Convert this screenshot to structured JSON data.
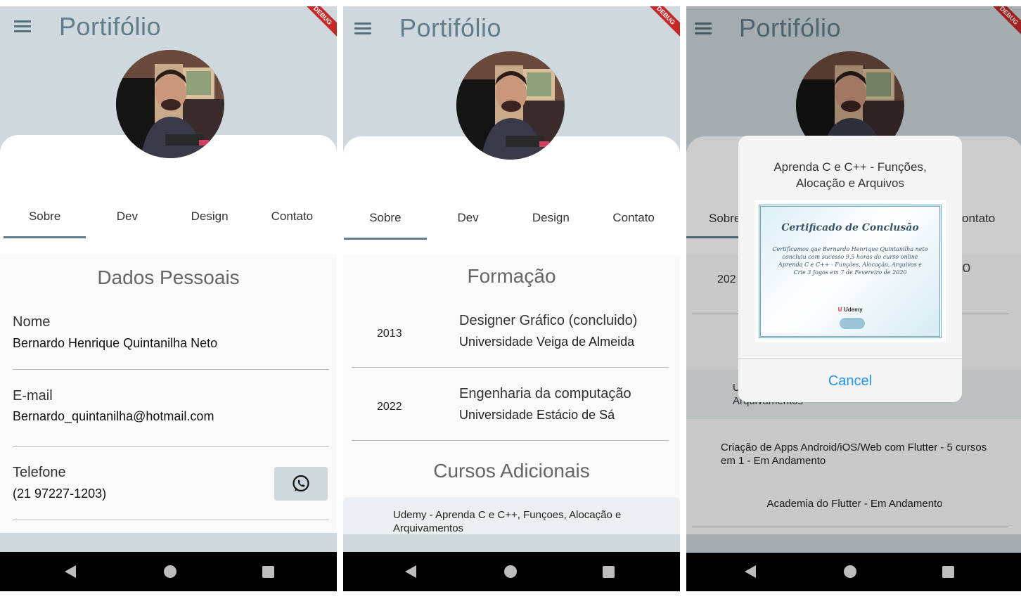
{
  "app": {
    "title": "Portifólio",
    "debug_banner": "DEBUG"
  },
  "tabs": [
    "Sobre",
    "Dev",
    "Design",
    "Contato"
  ],
  "screen1": {
    "section_title": "Dados Pessoais",
    "fields": [
      {
        "label": "Nome",
        "value": "Bernardo Henrique Quintanilha Neto"
      },
      {
        "label": "E-mail",
        "value": "Bernardo_quintanilha@hotmail.com"
      },
      {
        "label": "Telefone",
        "value": "(21 97227-1203)"
      }
    ]
  },
  "screen2": {
    "formacao_title": "Formação",
    "education": [
      {
        "year": "2013",
        "course": "Designer Gráfico (concluido)",
        "school": "Universidade Veiga de Almeida"
      },
      {
        "year": "2022",
        "course": "Engenharia da computação",
        "school": "Universidade Estácio de Sá"
      }
    ],
    "cursos_title": "Cursos Adicionais",
    "extra_courses": [
      "Udemy - Aprenda C e C++, Funçoes, Alocação e Arquivamentos"
    ]
  },
  "screen3": {
    "visible_background": {
      "tab_sobre_partial": "Sobre",
      "tab_contato_partial": "ontato",
      "title_partial": "ão",
      "year_partial": "202",
      "extra_partial_1": "U",
      "extra_partial_2": "Arquivamentos",
      "courses": [
        "Criação de Apps Android/iOS/Web com Flutter - 5 cursos em 1 - Em Andamento",
        "Academia do Flutter - Em Andamento"
      ]
    },
    "dialog": {
      "title": "Aprenda C e C++ - Funções, Alocação e Arquivos",
      "certificate": {
        "heading": "Certificado de Conclusão",
        "body": "Certificamos que Bernardo Henrique Quintanilha neto concluiu com sucesso 9,5 horas do curso online Aprenda C e C++ - Funções, Alocação, Arquivos e Crie 3 Jogos em 7 de Fevereiro de 2020",
        "brand": "Udemy"
      },
      "cancel_label": "Cancel"
    }
  },
  "colors": {
    "appbar": "#cfd8dc",
    "title": "#607d8b",
    "accent": "#607d8b",
    "cancel": "#2196f3",
    "navbar": "#000000"
  },
  "icons": [
    "menu-icon",
    "whatsapp-icon",
    "nav-back-icon",
    "nav-home-icon",
    "nav-recent-icon"
  ]
}
